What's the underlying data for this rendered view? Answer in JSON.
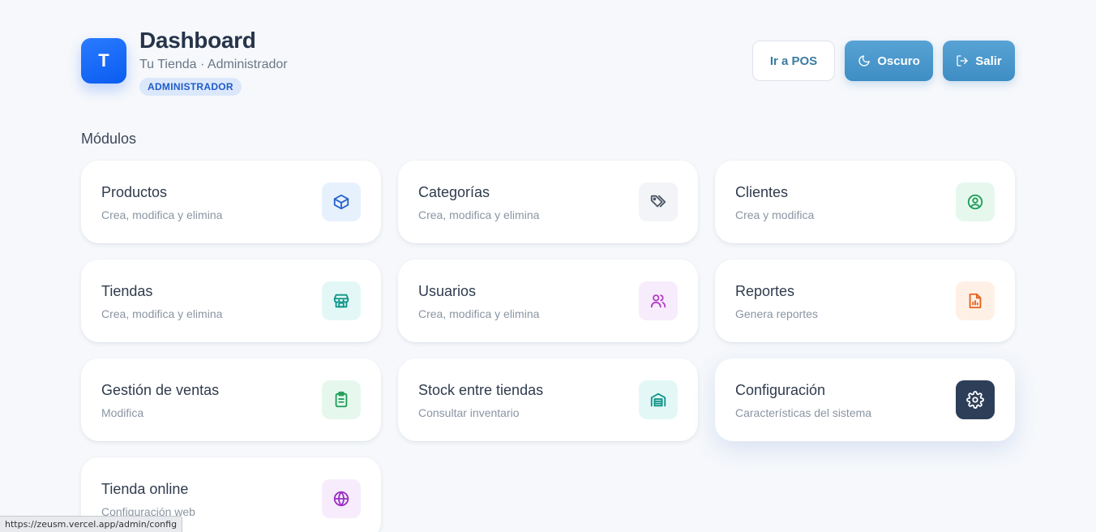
{
  "header": {
    "avatar_letter": "T",
    "title": "Dashboard",
    "subtitle": "Tu Tienda · Administrador",
    "role_badge": "ADMINISTRADOR",
    "buttons": {
      "pos": "Ir a POS",
      "dark_mode": "Oscuro",
      "logout": "Salir"
    }
  },
  "section_title": "Módulos",
  "modules": [
    {
      "title": "Productos",
      "desc": "Crea, modifica y elimina",
      "icon": "box-icon",
      "color": "#2563c9"
    },
    {
      "title": "Categorías",
      "desc": "Crea, modifica y elimina",
      "icon": "tags-icon",
      "color": "#4b5563"
    },
    {
      "title": "Clientes",
      "desc": "Crea y modifica",
      "icon": "user-circle-icon",
      "color": "#1f9d57"
    },
    {
      "title": "Tiendas",
      "desc": "Crea, modifica y elimina",
      "icon": "store-icon",
      "color": "#0f9488"
    },
    {
      "title": "Usuarios",
      "desc": "Crea, modifica y elimina",
      "icon": "users-icon",
      "color": "#b43ec4"
    },
    {
      "title": "Reportes",
      "desc": "Genera reportes",
      "icon": "report-icon",
      "color": "#e2611d"
    },
    {
      "title": "Gestión de ventas",
      "desc": "Modifica",
      "icon": "clipboard-list-icon",
      "color": "#1f9d57"
    },
    {
      "title": "Stock entre tiendas",
      "desc": "Consultar inventario",
      "icon": "warehouse-icon",
      "color": "#0f9488"
    },
    {
      "title": "Configuración",
      "desc": "Características del sistema",
      "icon": "gear-icon",
      "color": "#2c3e58"
    },
    {
      "title": "Tienda online",
      "desc": "Configuración web",
      "icon": "globe-icon",
      "color": "#9b2fc2"
    }
  ],
  "status_bar": {
    "url": "https://zeusm.vercel.app/admin/config"
  }
}
